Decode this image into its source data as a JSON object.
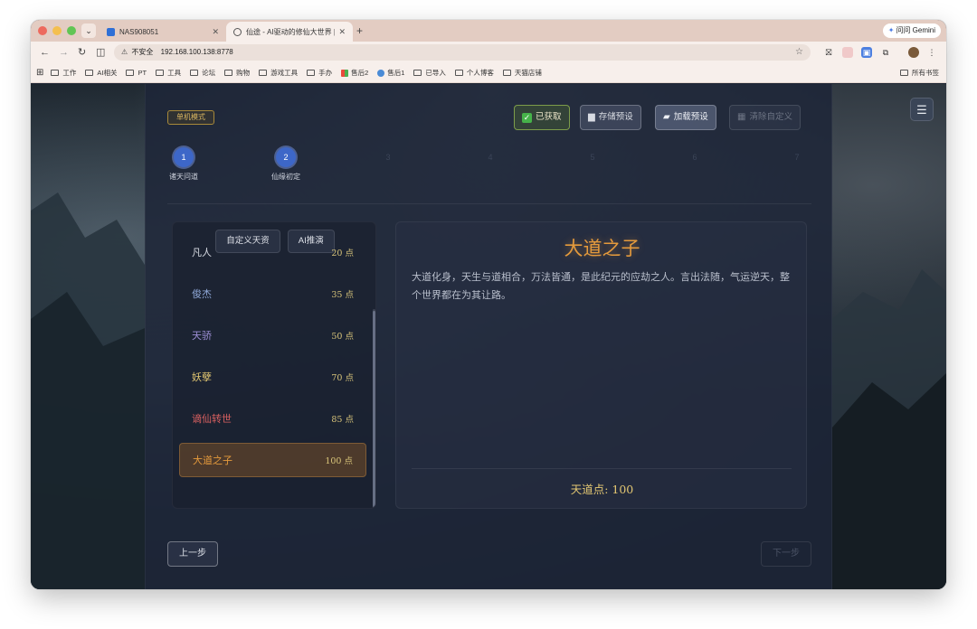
{
  "browser": {
    "tabs": [
      {
        "title": "NAS908051",
        "active": false
      },
      {
        "title": "仙途 - AI驱动的修仙大世界 | AI",
        "active": true
      }
    ],
    "new_tab": "+",
    "gemini_label": "问问 Gemini",
    "url_warning": "不安全",
    "url": "192.168.100.138:8778",
    "bookmarks": [
      "工作",
      "AI相关",
      "PT",
      "工具",
      "论坛",
      "购物",
      "游戏工具",
      "手办",
      "售后2",
      "售后1",
      "已导入",
      "个人博客",
      "天猫店铺"
    ],
    "all_bookmarks": "所有书签"
  },
  "app": {
    "mode_badge": "单机模式",
    "buttons": {
      "acquired": "已获取",
      "save_preset": "存储预设",
      "load_preset": "加载预设",
      "clear_custom": "清除自定义"
    },
    "steps": [
      {
        "num": "1",
        "label": "诸天问道",
        "active": true
      },
      {
        "num": "2",
        "label": "仙缘初定",
        "active": true
      },
      {
        "num": "3",
        "label": "",
        "active": false
      },
      {
        "num": "4",
        "label": "",
        "active": false
      },
      {
        "num": "5",
        "label": "",
        "active": false
      },
      {
        "num": "6",
        "label": "",
        "active": false
      },
      {
        "num": "7",
        "label": "",
        "active": false
      }
    ],
    "list_tabs": {
      "custom": "自定义天资",
      "ai": "AI推演"
    },
    "talents": [
      {
        "name": "凡人",
        "points": "20 点",
        "color": "#d6dae2",
        "selected": false
      },
      {
        "name": "俊杰",
        "points": "35 点",
        "color": "#8fa8d8",
        "selected": false
      },
      {
        "name": "天骄",
        "points": "50 点",
        "color": "#9d8fd6",
        "selected": false
      },
      {
        "name": "妖孽",
        "points": "70 点",
        "color": "#e3c772",
        "selected": false
      },
      {
        "name": "谪仙转世",
        "points": "85 点",
        "color": "#d86060",
        "selected": false
      },
      {
        "name": "大道之子",
        "points": "100 点",
        "color": "#e49a3c",
        "selected": true
      }
    ],
    "detail": {
      "title": "大道之子",
      "description": "大道化身，天生与道相合，万法皆通，是此纪元的应劫之人。言出法随，气运逆天，整个世界都在为其让路。",
      "points_label": "天道点: 100"
    },
    "prev": "上一步",
    "next": "下一步"
  }
}
